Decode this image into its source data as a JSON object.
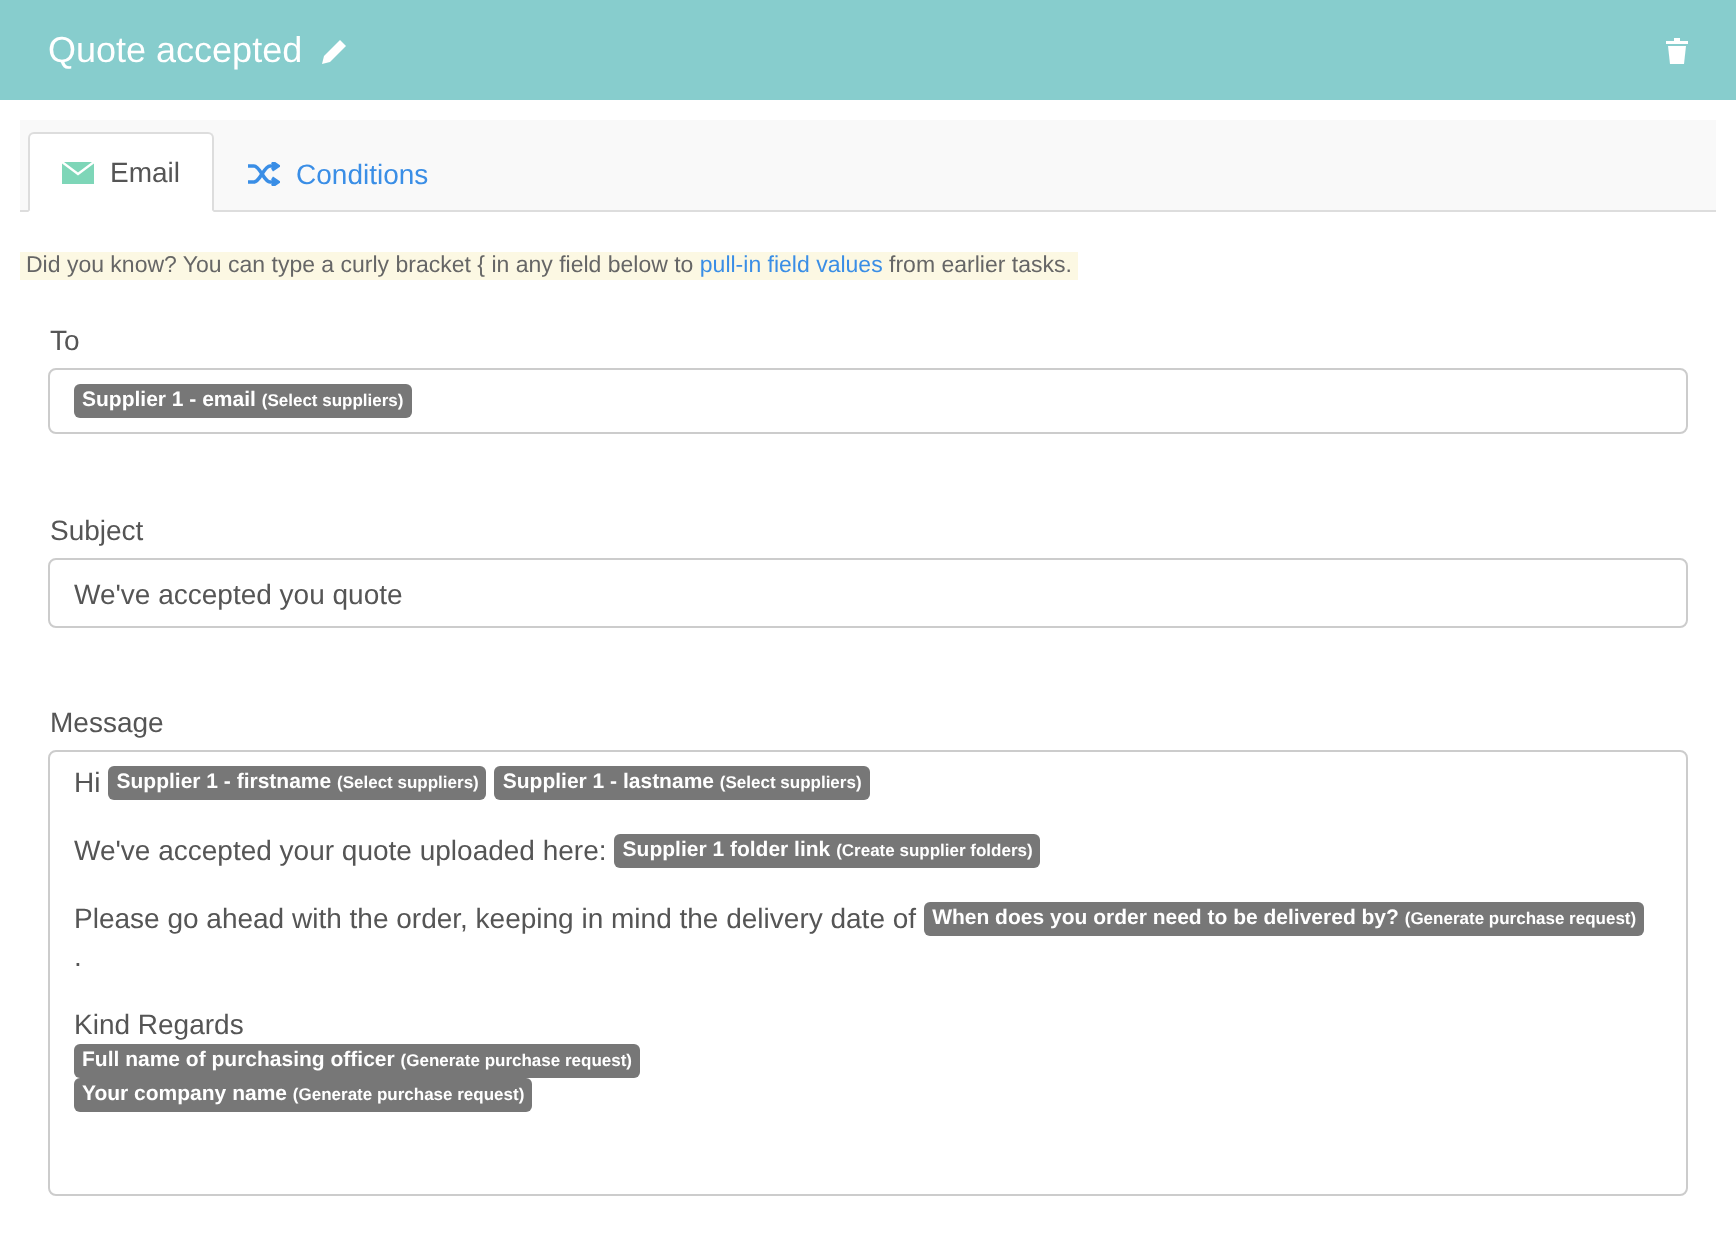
{
  "header": {
    "title": "Quote accepted"
  },
  "tabs": [
    {
      "label": "Email",
      "selected": true
    },
    {
      "label": "Conditions",
      "selected": false
    }
  ],
  "hint": {
    "text": "Did you know? You can type a curly bracket { in any field below to",
    "link": "pull-in field values",
    "after": "from earlier tasks."
  },
  "to": {
    "label": "To",
    "tags": [
      {
        "field": "Supplier 1 - email",
        "source": "(Select suppliers)"
      }
    ]
  },
  "subject": {
    "label": "Subject",
    "value": "We've accepted you quote"
  },
  "message": {
    "label": "Message",
    "blocks": [
      [
        [
          {
            "kind": "text",
            "text": "Hi"
          },
          {
            "kind": "tag",
            "field": "Supplier 1 - firstname",
            "source": "(Select suppliers)"
          },
          {
            "kind": "tag",
            "field": "Supplier 1 - lastname",
            "source": "(Select suppliers)"
          }
        ]
      ],
      [
        [
          {
            "kind": "text",
            "text": "We've accepted your quote uploaded here:"
          },
          {
            "kind": "tag",
            "field": "Supplier 1 folder link",
            "source": "(Create supplier folders)"
          }
        ]
      ],
      [
        [
          {
            "kind": "text",
            "text": "Please go ahead with the order, keeping in mind the delivery date of"
          },
          {
            "kind": "tag",
            "field": "When does you order need to be delivered by?",
            "source": "(Generate purchase request)"
          }
        ],
        [
          {
            "kind": "text",
            "text": "."
          }
        ]
      ],
      [
        [
          {
            "kind": "text",
            "text": "Kind Regards"
          }
        ],
        [
          {
            "kind": "tag",
            "field": "Full name of purchasing officer",
            "source": "(Generate purchase request)"
          }
        ],
        [
          {
            "kind": "tag",
            "field": "Your company name",
            "source": "(Generate purchase request)"
          }
        ]
      ]
    ]
  }
}
